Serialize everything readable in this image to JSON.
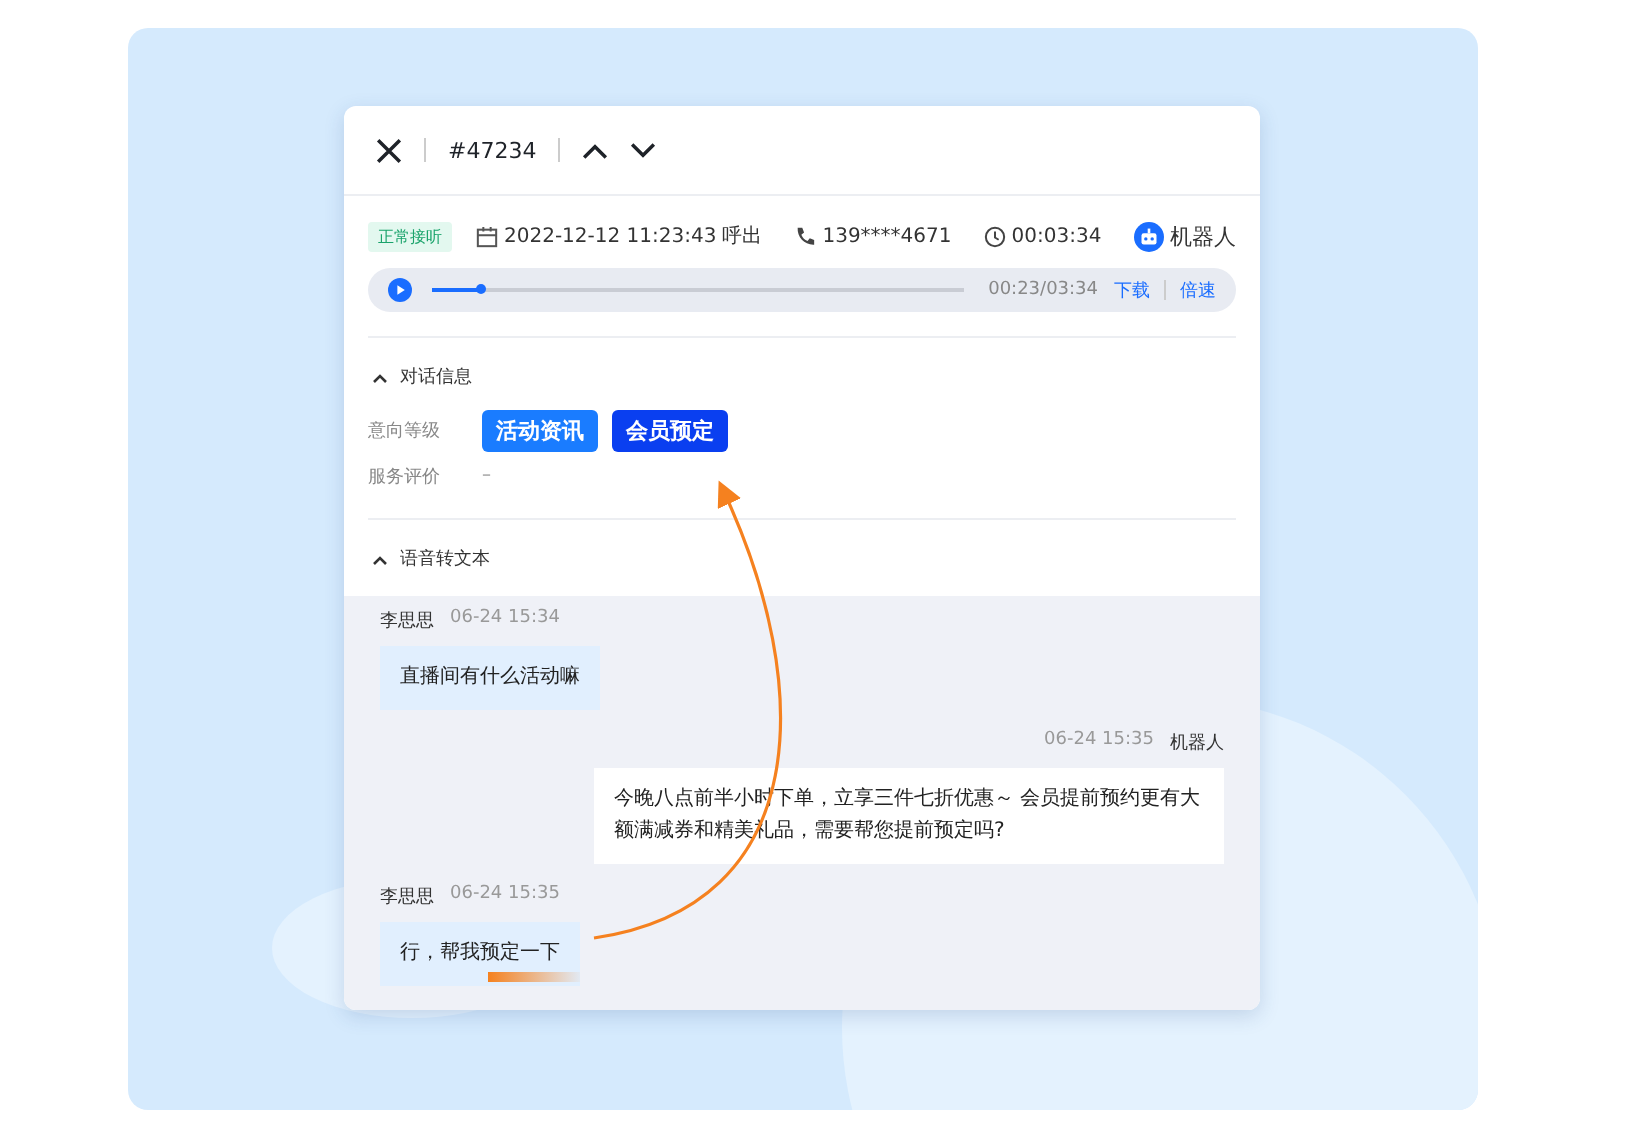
{
  "header": {
    "ticket": "#47234"
  },
  "call_info": {
    "status": "正常接听",
    "datetime": "2022-12-12 11:23:43",
    "direction": "呼出",
    "phone": "139****4671",
    "duration": "00:03:34",
    "agent": "机器人"
  },
  "player": {
    "level": 0.09,
    "time": "00:23/03:34",
    "download": "下载",
    "speed": "倍速"
  },
  "dialog_section": {
    "title": "对话信息",
    "expanded": true,
    "intent": {
      "label": "意向等级",
      "tags": [
        {
          "text": "活动资讯",
          "color": "#1a7cff"
        },
        {
          "text": "会员预定",
          "color": "#0a3ff0"
        }
      ]
    },
    "rating": {
      "label": "服务评价",
      "value": "–"
    }
  },
  "transcript_section": {
    "title": "语音转文本",
    "expanded": true
  },
  "messages": [
    {
      "kind": "incoming",
      "name": "李思思",
      "time": "06-24 15:34",
      "text": "直播间有什么活动嘛",
      "highlight": false
    },
    {
      "kind": "outgoing",
      "name": "机器人",
      "time": "06-24 15:35",
      "text": "今晚八点前半小时下单，立享三件七折优惠～ 会员提前预约更有大额满减券和精美礼品，需要帮您提前预定吗?",
      "highlight": false
    },
    {
      "kind": "incoming",
      "name": "李思思",
      "time": "06-24 15:35",
      "text": "行，帮我预定一下",
      "highlight": true
    }
  ]
}
